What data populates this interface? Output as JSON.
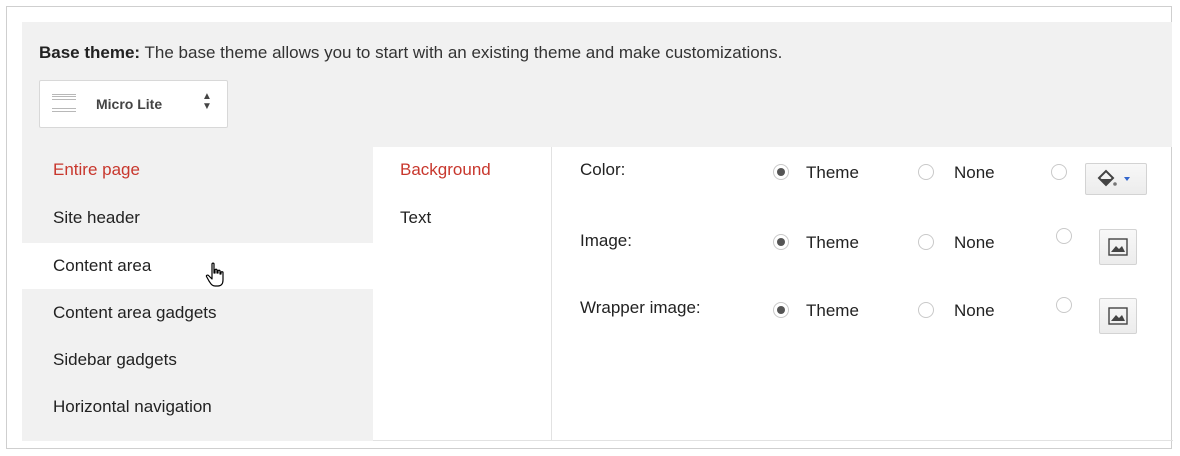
{
  "base_theme": {
    "label": "Base theme:",
    "description": "The base theme allows you to start with an existing theme and make customizations.",
    "selected_theme": "Micro Lite"
  },
  "sections": [
    {
      "label": "Entire page",
      "active": true
    },
    {
      "label": "Site header"
    },
    {
      "label": "Content area",
      "hover": true
    },
    {
      "label": "Content area gadgets"
    },
    {
      "label": "Sidebar gadgets"
    },
    {
      "label": "Horizontal navigation"
    }
  ],
  "subsections": [
    {
      "label": "Background",
      "active": true
    },
    {
      "label": "Text"
    }
  ],
  "properties": [
    {
      "label": "Color:",
      "options": [
        "Theme",
        "None"
      ],
      "selected": "Theme",
      "custom_button_icon": "paint-bucket-icon"
    },
    {
      "label": "Image:",
      "options": [
        "Theme",
        "None"
      ],
      "selected": "Theme",
      "custom_button_icon": "image-icon"
    },
    {
      "label": "Wrapper image:",
      "options": [
        "Theme",
        "None"
      ],
      "selected": "Theme",
      "custom_button_icon": "image-icon"
    }
  ],
  "colors": {
    "accent_red": "#c8372d",
    "panel_gray": "#f1f1f1",
    "dropdown_arrow_blue": "#3366cc"
  }
}
